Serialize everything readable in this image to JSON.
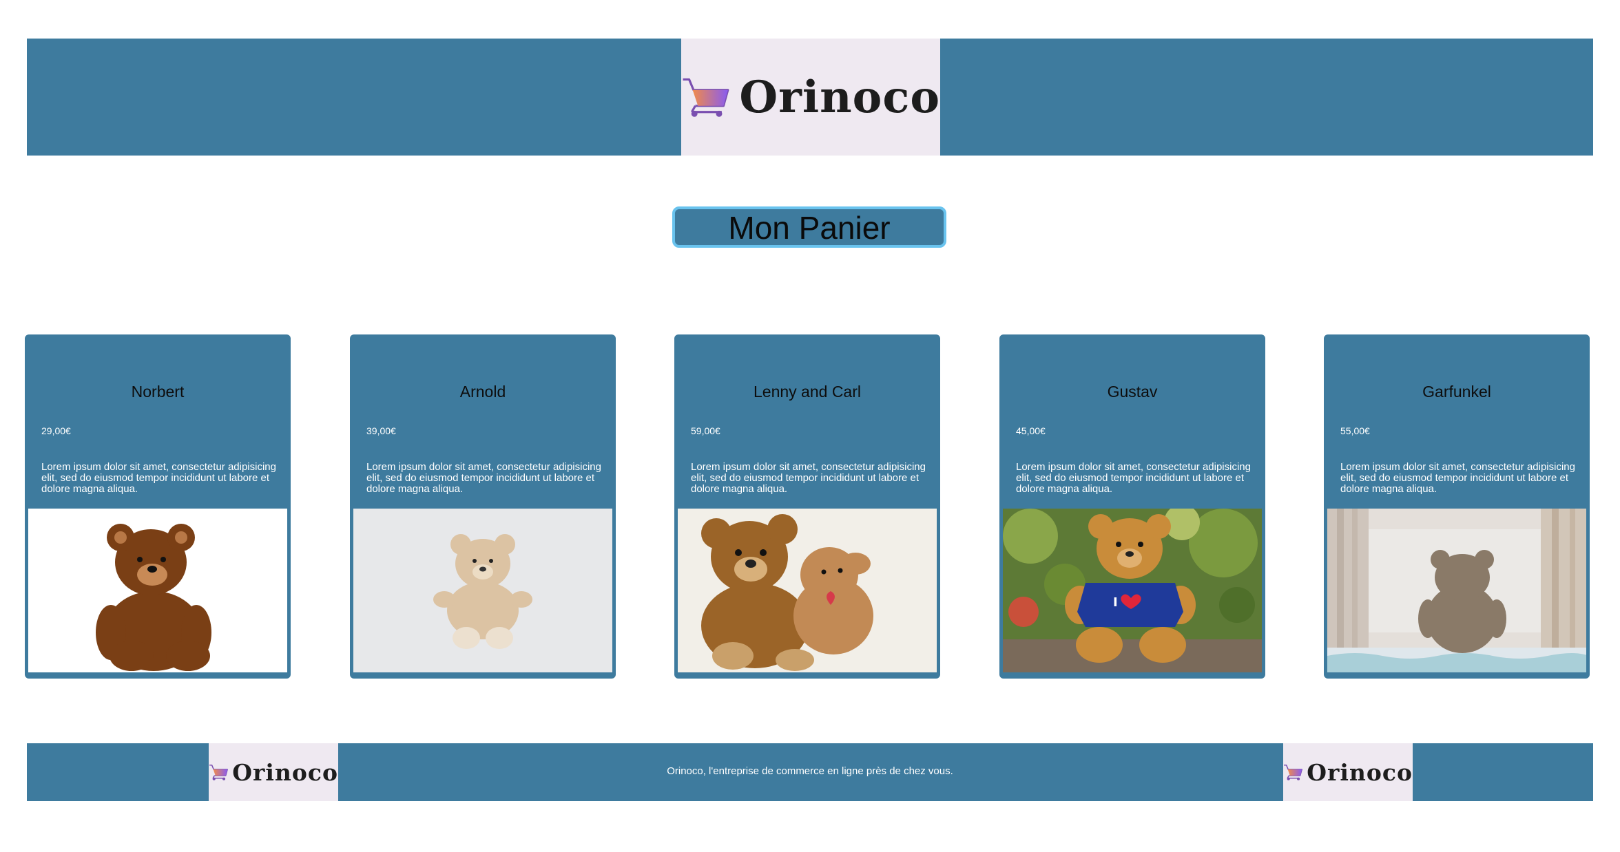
{
  "brand": {
    "name": "Orinoco"
  },
  "header": {
    "logo_text": "Orinoco"
  },
  "cart_button": {
    "label": "Mon Panier"
  },
  "products": [
    {
      "name": "Norbert",
      "price": "29,00€",
      "description": "Lorem ipsum dolor sit amet, consectetur adipisicing elit, sed do eiusmod tempor incididunt ut labore et dolore magna aliqua.",
      "image": "teddy-bear-brown-white-bg"
    },
    {
      "name": "Arnold",
      "price": "39,00€",
      "description": "Lorem ipsum dolor sit amet, consectetur adipisicing elit, sed do eiusmod tempor incididunt ut labore et dolore magna aliqua.",
      "image": "teddy-bear-beige-grey-bg"
    },
    {
      "name": "Lenny and Carl",
      "price": "59,00€",
      "description": "Lorem ipsum dolor sit amet, consectetur adipisicing elit, sed do eiusmod tempor incididunt ut labore et dolore magna aliqua.",
      "image": "two-teddy-bears-hugging"
    },
    {
      "name": "Gustav",
      "price": "45,00€",
      "description": "Lorem ipsum dolor sit amet, consectetur adipisicing elit, sed do eiusmod tempor incididunt ut labore et dolore magna aliqua.",
      "image": "teddy-bear-blue-shirt-garden"
    },
    {
      "name": "Garfunkel",
      "price": "55,00€",
      "description": "Lorem ipsum dolor sit amet, consectetur adipisicing elit, sed do eiusmod tempor incididunt ut labore et dolore magna aliqua.",
      "image": "teddy-bear-back-window"
    }
  ],
  "footer": {
    "tagline": "Orinoco, l'entreprise de commerce en ligne près de chez vous.",
    "logo_text": "Orinoco"
  },
  "colors": {
    "bar": "#3e7b9e",
    "logo_bg": "#efe9f1",
    "button_border": "#69c3ee",
    "text_dark": "#0d0d0d"
  },
  "icons": {
    "logo": "shopping-cart-icon"
  }
}
